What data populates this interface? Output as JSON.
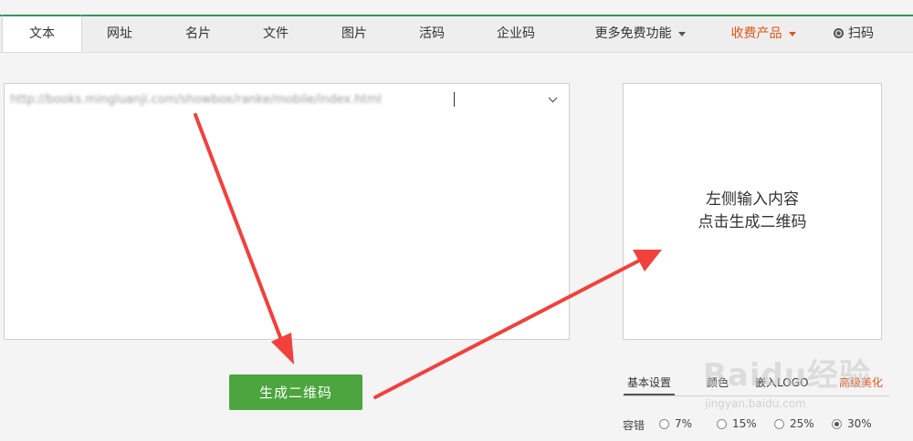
{
  "tabs": [
    {
      "label": "文本",
      "active": true
    },
    {
      "label": "网址"
    },
    {
      "label": "名片"
    },
    {
      "label": "文件"
    },
    {
      "label": "图片"
    },
    {
      "label": "活码"
    },
    {
      "label": "企业码"
    },
    {
      "label": "更多免费功能",
      "icon": "caret-down-icon"
    },
    {
      "label": "收费产品",
      "icon": "caret-down-icon",
      "color": "#e0541a"
    },
    {
      "label": "扫码",
      "icon": "scan-icon"
    }
  ],
  "input": {
    "value": "http://books.mingluanji.com/showbox/ranke/mobile/index.html"
  },
  "generate_button": {
    "label": "生成二维码",
    "color": "#4ca53e"
  },
  "preview": {
    "line1": "左侧输入内容",
    "line2": "点击生成二维码"
  },
  "settings_tabs": [
    {
      "label": "基本设置",
      "active": true
    },
    {
      "label": "颜色"
    },
    {
      "label": "嵌入LOGO"
    },
    {
      "label": "高级美化",
      "color": "#e0541a"
    }
  ],
  "tolerance": {
    "label": "容错",
    "options": [
      {
        "label": "7%"
      },
      {
        "label": "15%"
      },
      {
        "label": "25%"
      },
      {
        "label": "30%",
        "checked": true
      }
    ]
  },
  "watermark": {
    "brand": "Baidu经验",
    "url": "jingyan.baidu.com"
  },
  "colors": {
    "accent_green": "#2e9a5a",
    "button_green": "#4ca53e",
    "paid_orange": "#e0541a",
    "arrow_red": "#f2403c"
  }
}
